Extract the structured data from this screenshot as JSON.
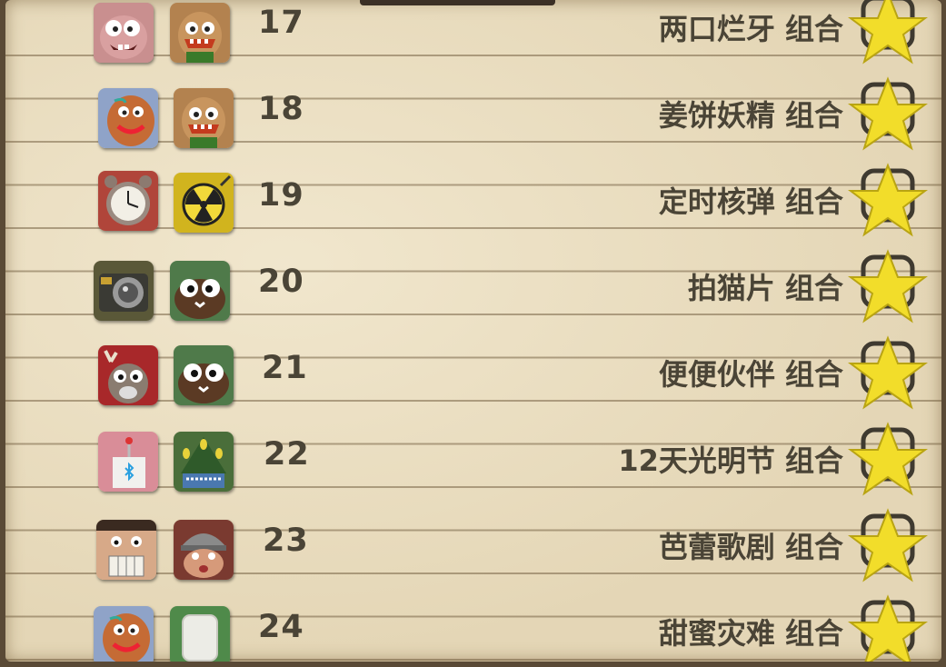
{
  "rows": [
    {
      "number": "17",
      "label": "两口烂牙 组合",
      "icons": [
        "pink-monster-icon",
        "goblin-icon"
      ]
    },
    {
      "number": "18",
      "label": "姜饼妖精 组合",
      "icons": [
        "gingerbread-icon",
        "goblin-icon"
      ]
    },
    {
      "number": "19",
      "label": "定时核弹 组合",
      "icons": [
        "alarm-clock-icon",
        "nuclear-bomb-icon"
      ]
    },
    {
      "number": "20",
      "label": "拍猫片 组合",
      "icons": [
        "camera-icon",
        "furry-critter-icon"
      ]
    },
    {
      "number": "21",
      "label": "便便伙伴 组合",
      "icons": [
        "reindeer-icon",
        "furry-critter-icon"
      ]
    },
    {
      "number": "22",
      "label": "12天光明节 组合",
      "icons": [
        "robot-gift-icon",
        "tree-monster-icon"
      ]
    },
    {
      "number": "23",
      "label": "芭蕾歌剧 组合",
      "icons": [
        "nutcracker-icon",
        "viking-icon"
      ]
    },
    {
      "number": "24",
      "label": "甜蜜灾难 组合",
      "icons": [
        "gingerbread-icon",
        "marshmallow-icon"
      ]
    }
  ],
  "colors": {
    "text": "#4a4436",
    "star": "#f2dd2a",
    "paper": "#e9dcbd"
  }
}
